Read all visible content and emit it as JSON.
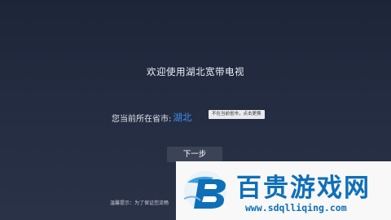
{
  "screen": {
    "welcome_title": "欢迎使用湖北宽带电视",
    "province_label": "您当前所在省市:",
    "province_value": "湖北",
    "change_tip": "不在当前省市，点击更换",
    "next_button": "下一步",
    "footer_note": "温馨提示：为了保证您流畅"
  },
  "watermark": {
    "title": "百贵游戏网",
    "url": "www.sdqlliqing.com"
  },
  "colors": {
    "background": "#1f283b",
    "accent_blue": "#3c8ff0",
    "button_bg": "#3b4457",
    "watermark_blue": "#0e6fb8"
  }
}
